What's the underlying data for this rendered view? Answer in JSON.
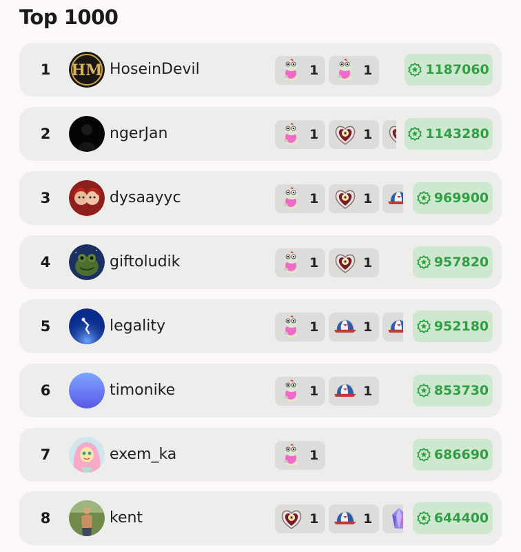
{
  "header": {
    "title": "Top 1000"
  },
  "icons": {
    "score": "star-badge-icon",
    "gift_types": [
      "frog-gift-icon",
      "heart-eye-gift-icon",
      "cap-gift-icon",
      "crystal-gift-icon"
    ]
  },
  "colors": {
    "score_text": "#2ea043",
    "score_bg": "#cde8cf",
    "row_bg": "#ededec",
    "gift_bg": "#dcdcdb"
  },
  "leaderboard": [
    {
      "rank": "1",
      "name": "HoseinDevil",
      "score": "1187060",
      "gifts": [
        {
          "type": "frog-gift",
          "count": "1"
        },
        {
          "type": "frog-gift",
          "count": "1"
        }
      ]
    },
    {
      "rank": "2",
      "name": "ngerJan",
      "score": "1143280",
      "gifts": [
        {
          "type": "frog-gift",
          "count": "1"
        },
        {
          "type": "heart-eye-gift",
          "count": "1"
        },
        {
          "type": "heart-eye-gift",
          "count": ""
        }
      ]
    },
    {
      "rank": "3",
      "name": "dysaayyc",
      "score": "969900",
      "gifts": [
        {
          "type": "frog-gift",
          "count": "1"
        },
        {
          "type": "heart-eye-gift",
          "count": "1"
        },
        {
          "type": "cap-gift",
          "count": ""
        }
      ]
    },
    {
      "rank": "4",
      "name": "giftoludik",
      "score": "957820",
      "gifts": [
        {
          "type": "frog-gift",
          "count": "1"
        },
        {
          "type": "heart-eye-gift",
          "count": "1"
        }
      ]
    },
    {
      "rank": "5",
      "name": "legality",
      "score": "952180",
      "gifts": [
        {
          "type": "frog-gift",
          "count": "1"
        },
        {
          "type": "cap-gift",
          "count": "1"
        },
        {
          "type": "cap-gift",
          "count": ""
        }
      ]
    },
    {
      "rank": "6",
      "name": "timonike",
      "score": "853730",
      "gifts": [
        {
          "type": "frog-gift",
          "count": "1"
        },
        {
          "type": "cap-gift",
          "count": "1"
        }
      ]
    },
    {
      "rank": "7",
      "name": "exem_ka",
      "score": "686690",
      "gifts": [
        {
          "type": "frog-gift",
          "count": "1"
        }
      ]
    },
    {
      "rank": "8",
      "name": "kent",
      "score": "644400",
      "gifts": [
        {
          "type": "heart-eye-gift",
          "count": "1"
        },
        {
          "type": "cap-gift",
          "count": "1"
        },
        {
          "type": "crystal-gift",
          "count": ""
        }
      ]
    }
  ]
}
